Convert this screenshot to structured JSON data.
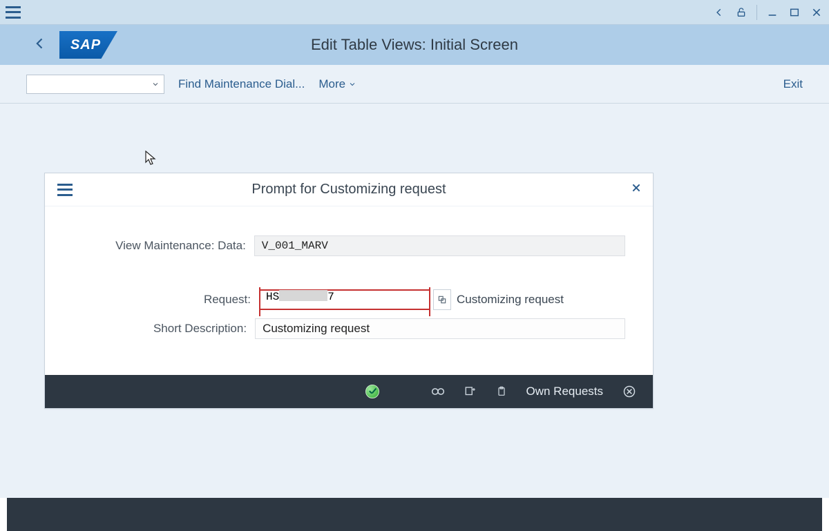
{
  "titlebar": {},
  "ribbon": {
    "title": "Edit Table Views: Initial Screen",
    "logo_text": "SAP"
  },
  "toolbar": {
    "find_label": "Find Maintenance Dial...",
    "more_label": "More",
    "exit_label": "Exit"
  },
  "modal": {
    "title": "Prompt for Customizing request",
    "view_maint_label": "View Maintenance: Data:",
    "view_maint_value": "V_001_MARV",
    "request_label": "Request:",
    "request_value_prefix": "HS",
    "request_value_suffix": "7",
    "request_hint": "Customizing request",
    "short_desc_label": "Short Description:",
    "short_desc_value": "Customizing request",
    "footer": {
      "own_requests": "Own Requests"
    }
  }
}
